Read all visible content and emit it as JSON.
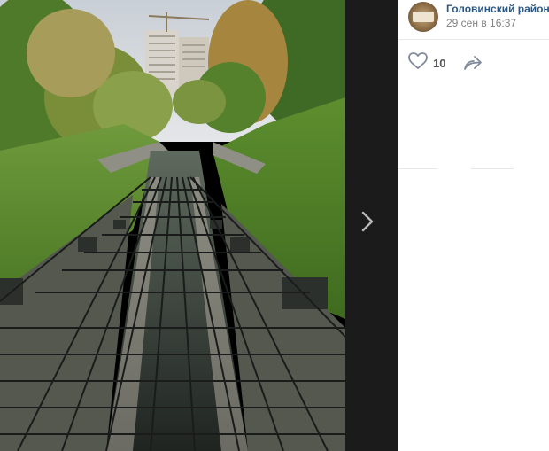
{
  "post": {
    "author": "Головинский район",
    "date": "29 сен в 16:37",
    "likes": "10"
  },
  "icons": {
    "like": "heart-icon",
    "share": "share-arrow-icon",
    "next": "chevron-right-icon",
    "avatar": "community-avatar"
  },
  "colors": {
    "author_link": "#2a5885",
    "date_text": "#828282",
    "viewer_strip": "#1b1b1b"
  }
}
